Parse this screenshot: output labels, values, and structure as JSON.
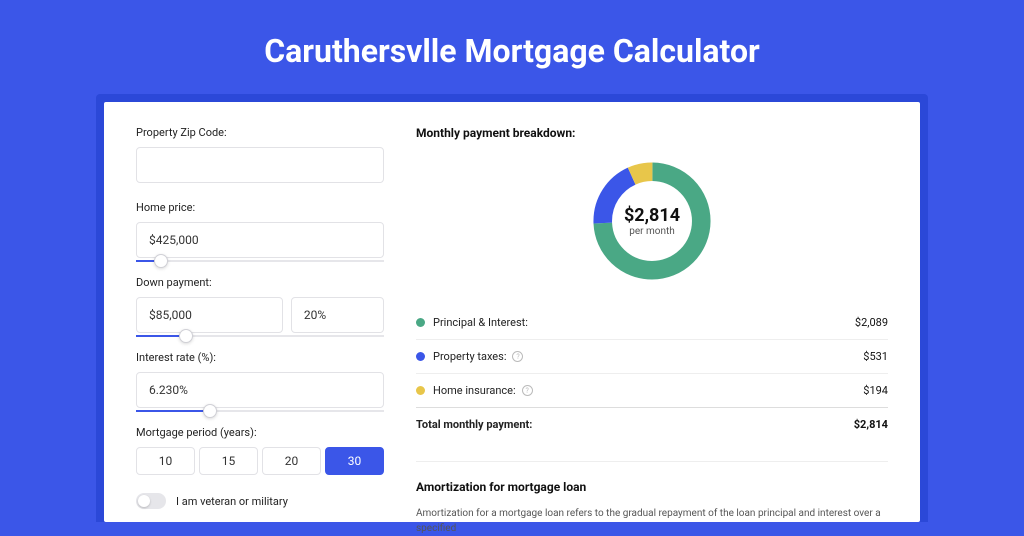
{
  "title": "Caruthersvlle Mortgage Calculator",
  "form": {
    "zip": {
      "label": "Property Zip Code:",
      "value": ""
    },
    "price": {
      "label": "Home price:",
      "value": "$425,000",
      "slider_pct": 10
    },
    "down": {
      "label": "Down payment:",
      "amount": "$85,000",
      "pct": "20%",
      "slider_pct": 20
    },
    "rate": {
      "label": "Interest rate (%):",
      "value": "6.230%",
      "slider_pct": 30
    },
    "period": {
      "label": "Mortgage period (years):",
      "options": [
        "10",
        "15",
        "20",
        "30"
      ],
      "active": "30"
    },
    "veteran": {
      "label": "I am veteran or military",
      "on": false
    }
  },
  "breakdown": {
    "title": "Monthly payment breakdown:",
    "center_value": "$2,814",
    "center_sub": "per month",
    "items": [
      {
        "color": "green",
        "label": "Principal & Interest:",
        "amount": "$2,089",
        "info": false
      },
      {
        "color": "blue",
        "label": "Property taxes:",
        "amount": "$531",
        "info": true
      },
      {
        "color": "yellow",
        "label": "Home insurance:",
        "amount": "$194",
        "info": true
      }
    ],
    "total_label": "Total monthly payment:",
    "total_amount": "$2,814"
  },
  "chart_data": {
    "type": "pie",
    "title": "Monthly payment breakdown",
    "series": [
      {
        "name": "Principal & Interest",
        "value": 2089,
        "color": "#4aa885"
      },
      {
        "name": "Property taxes",
        "value": 531,
        "color": "#3b56e8"
      },
      {
        "name": "Home insurance",
        "value": 194,
        "color": "#e8c64a"
      }
    ],
    "total": 2814
  },
  "amortization": {
    "title": "Amortization for mortgage loan",
    "body": "Amortization for a mortgage loan refers to the gradual repayment of the loan principal and interest over a specified"
  }
}
